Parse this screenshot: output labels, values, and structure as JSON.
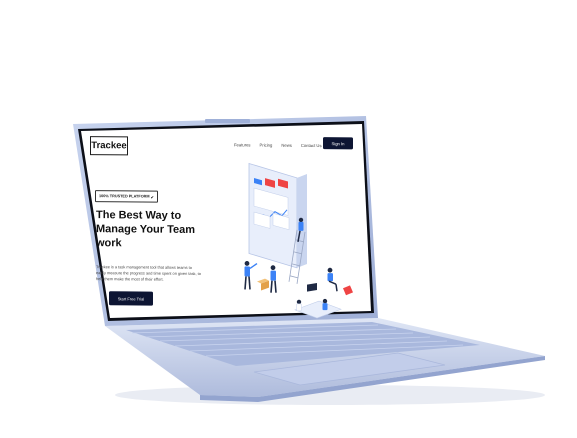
{
  "brand": {
    "name": "Trackee"
  },
  "nav": {
    "links": [
      "Features",
      "Pricing",
      "News",
      "Contact Us"
    ],
    "signin_label": "Sign In"
  },
  "hero": {
    "badge": "100% TRUSTED PLATFORM",
    "title_lines": [
      "The Best Way to",
      "Manage Your Team",
      "work"
    ],
    "description_lines": [
      "Trackee is a task management tool that allows teams to",
      "easily measure the progress and time spent on given task, to",
      "help them make the most of their effort."
    ],
    "cta_label": "Start Free Trial"
  },
  "icons": {
    "badge_check": "check-icon",
    "illustration": "team-dashboard-illustration"
  },
  "colors": {
    "primary_dark": "#0d1533",
    "accent_blue": "#3b82f6",
    "accent_red": "#ef4444",
    "laptop_body": "#b9c7e8"
  }
}
